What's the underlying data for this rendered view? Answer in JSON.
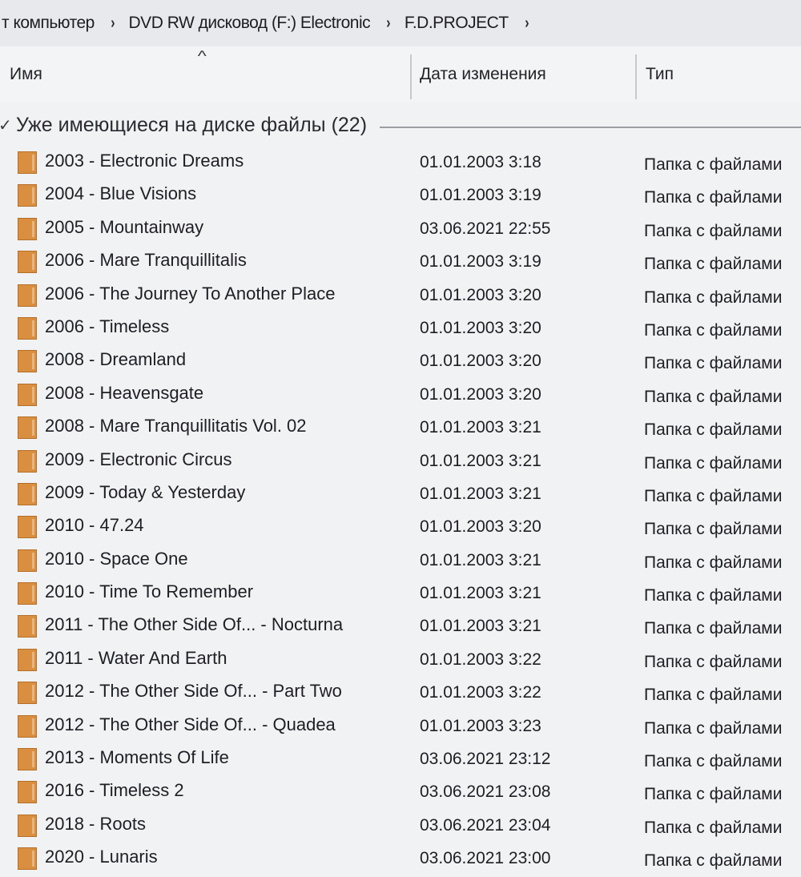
{
  "breadcrumb": {
    "items": [
      "т компьютер",
      "DVD RW дисковод (F:) Electronic",
      "F.D.PROJECT"
    ],
    "separator": "›"
  },
  "columns": {
    "name": "Имя",
    "date": "Дата изменения",
    "type": "Тип",
    "sort_arrow": "^"
  },
  "group": {
    "chevron": "✓",
    "title": "Уже имеющиеся на диске файлы (22)"
  },
  "files": [
    {
      "name": "2003 - Electronic Dreams",
      "date": "01.01.2003 3:18",
      "type": "Папка с файлами"
    },
    {
      "name": "2004 - Blue Visions",
      "date": "01.01.2003 3:19",
      "type": "Папка с файлами"
    },
    {
      "name": "2005 - Mountainway",
      "date": "03.06.2021 22:55",
      "type": "Папка с файлами"
    },
    {
      "name": "2006 - Mare Tranquillitalis",
      "date": "01.01.2003 3:19",
      "type": "Папка с файлами"
    },
    {
      "name": "2006 - The Journey To Another Place",
      "date": "01.01.2003 3:20",
      "type": "Папка с файлами"
    },
    {
      "name": "2006 - Timeless",
      "date": "01.01.2003 3:20",
      "type": "Папка с файлами"
    },
    {
      "name": "2008 - Dreamland",
      "date": "01.01.2003 3:20",
      "type": "Папка с файлами"
    },
    {
      "name": "2008 - Heavensgate",
      "date": "01.01.2003 3:20",
      "type": "Папка с файлами"
    },
    {
      "name": "2008 - Mare Tranquillitatis Vol. 02",
      "date": "01.01.2003 3:21",
      "type": "Папка с файлами"
    },
    {
      "name": "2009 - Electronic Circus",
      "date": "01.01.2003 3:21",
      "type": "Папка с файлами"
    },
    {
      "name": "2009 - Today & Yesterday",
      "date": "01.01.2003 3:21",
      "type": "Папка с файлами"
    },
    {
      "name": "2010 - 47.24",
      "date": "01.01.2003 3:20",
      "type": "Папка с файлами"
    },
    {
      "name": "2010 - Space One",
      "date": "01.01.2003 3:21",
      "type": "Папка с файлами"
    },
    {
      "name": "2010 - Time To Remember",
      "date": "01.01.2003 3:21",
      "type": "Папка с файлами"
    },
    {
      "name": "2011 - The Other Side Of... - Nocturna",
      "date": "01.01.2003 3:21",
      "type": "Папка с файлами"
    },
    {
      "name": "2011 - Water And Earth",
      "date": "01.01.2003 3:22",
      "type": "Папка с файлами"
    },
    {
      "name": "2012 - The Other Side Of... - Part Two",
      "date": "01.01.2003 3:22",
      "type": "Папка с файлами"
    },
    {
      "name": "2012 - The Other Side Of... - Quadea",
      "date": "01.01.2003 3:23",
      "type": "Папка с файлами"
    },
    {
      "name": "2013 - Moments Of Life",
      "date": "03.06.2021 23:12",
      "type": "Папка с файлами"
    },
    {
      "name": "2016 - Timeless 2",
      "date": "03.06.2021 23:08",
      "type": "Папка с файлами"
    },
    {
      "name": "2018 - Roots",
      "date": "03.06.2021 23:04",
      "type": "Папка с файлами"
    },
    {
      "name": "2020 - Lunaris",
      "date": "03.06.2021 23:00",
      "type": "Папка с файлами"
    }
  ],
  "colors": {
    "folder": "#d98f3f",
    "background": "#f1f2f4"
  }
}
